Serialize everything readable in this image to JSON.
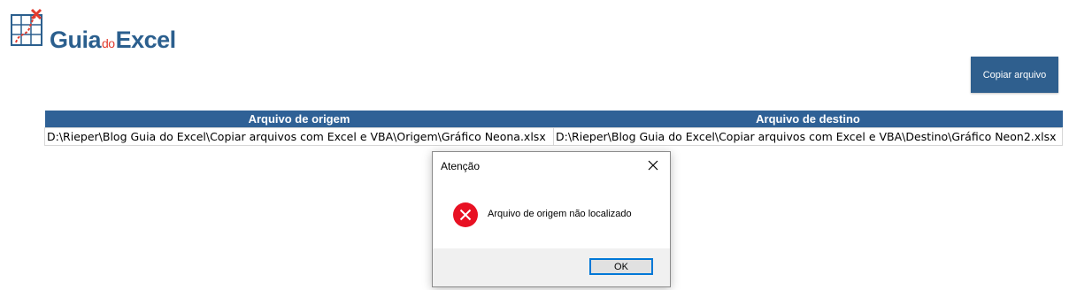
{
  "logo": {
    "part1": "Guia",
    "part2": "do",
    "part3": "Excel"
  },
  "toolbar": {
    "copy_label": "Copiar arquivo"
  },
  "table": {
    "headers": [
      "Arquivo de origem",
      "Arquivo de destino"
    ],
    "row": [
      "D:\\Rieper\\Blog Guia do Excel\\Copiar arquivos com Excel e VBA\\Origem\\Gráfico Neona.xlsx",
      "D:\\Rieper\\Blog Guia do Excel\\Copiar arquivos com Excel e VBA\\Destino\\Gráfico Neon2.xlsx"
    ]
  },
  "dialog": {
    "title": "Atenção",
    "message": "Arquivo de origem não localizado",
    "ok_label": "OK",
    "icon": "error-icon"
  },
  "colors": {
    "brand": "#2b5f8e",
    "header": "#2f6196",
    "error": "#e81123",
    "focus": "#0078d7"
  }
}
